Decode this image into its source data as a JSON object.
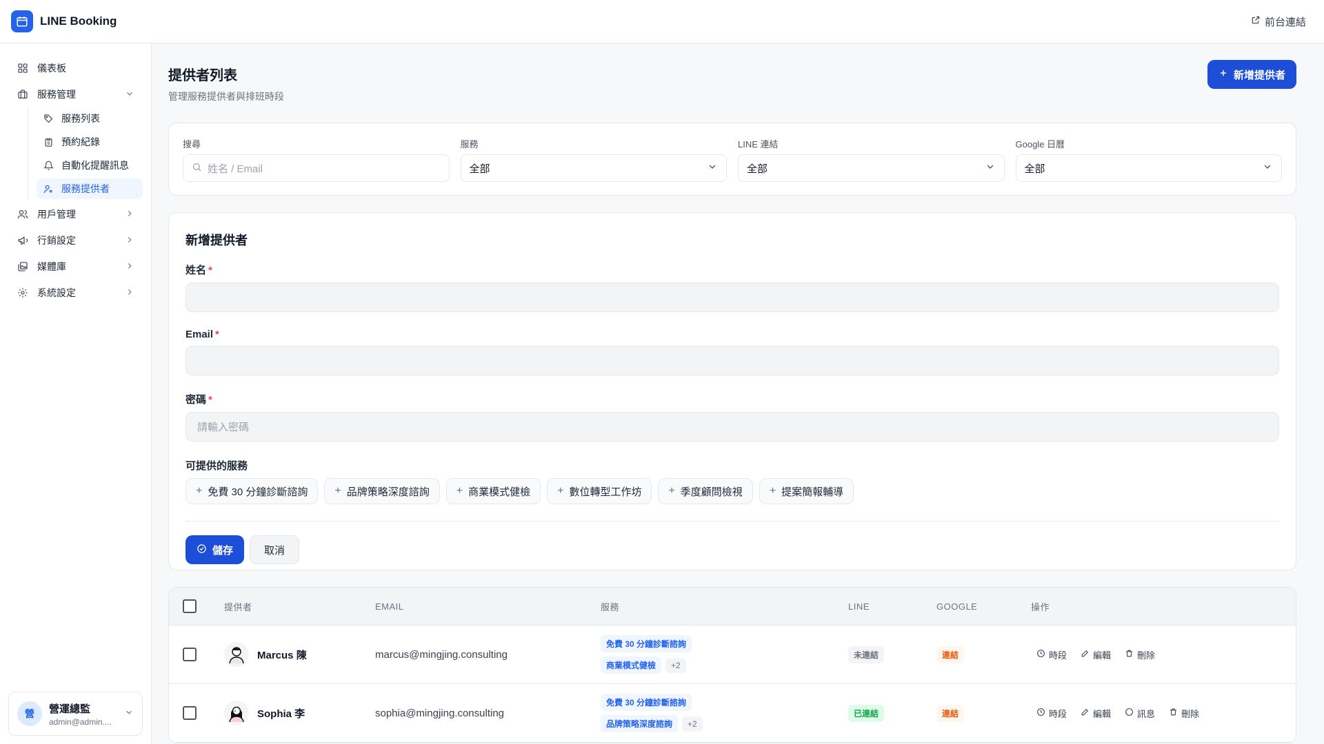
{
  "app": {
    "title": "LINE Booking",
    "front_link": "前台連結"
  },
  "sidebar": {
    "dashboard": "儀表板",
    "service_mgmt": "服務管理",
    "sub": [
      "服務列表",
      "預約紀錄",
      "自動化提醒訊息",
      "服務提供者"
    ],
    "user_mgmt": "用戶管理",
    "marketing": "行銷設定",
    "media": "媒體庫",
    "settings": "系統設定"
  },
  "user": {
    "initial": "營",
    "name": "營運總監",
    "email": "admin@admin...."
  },
  "page": {
    "title": "提供者列表",
    "subtitle": "管理服務提供者與排班時段",
    "add_button": "新增提供者"
  },
  "filters": {
    "search_label": "搜尋",
    "search_placeholder": "姓名 / Email",
    "service_label": "服務",
    "service_value": "全部",
    "line_label": "LINE 連結",
    "line_value": "全部",
    "google_label": "Google 日曆",
    "google_value": "全部"
  },
  "form": {
    "title": "新增提供者",
    "name_label": "姓名",
    "email_label": "Email",
    "password_label": "密碼",
    "password_placeholder": "請輸入密碼",
    "required_mark": "*",
    "services_label": "可提供的服務",
    "services": [
      "免費 30 分鐘診斷諮詢",
      "品牌策略深度諮詢",
      "商業模式健檢",
      "數位轉型工作坊",
      "季度顧問檢視",
      "提案簡報輔導"
    ],
    "save": "儲存",
    "cancel": "取消"
  },
  "table": {
    "headers": {
      "provider": "提供者",
      "email": "EMAIL",
      "service": "服務",
      "line": "LINE",
      "google": "GOOGLE",
      "actions": "操作"
    },
    "rows": [
      {
        "name": "Marcus 陳",
        "email": "marcus@mingjing.consulting",
        "tag1": "免費 30 分鐘診斷諮詢",
        "tag2": "商業模式健檢",
        "more": "+2",
        "line": "未連結",
        "google": "連結",
        "a1": "時段",
        "a2": "編輯",
        "a3": "刪除"
      },
      {
        "name": "Sophia 李",
        "email": "sophia@mingjing.consulting",
        "tag1": "免費 30 分鐘診斷諮詢",
        "tag2": "品牌策略深度諮詢",
        "more": "+2",
        "line": "已連結",
        "google": "連結",
        "a1": "時段",
        "a2": "編輯",
        "a3": "訊息",
        "a4": "刪除"
      }
    ]
  }
}
